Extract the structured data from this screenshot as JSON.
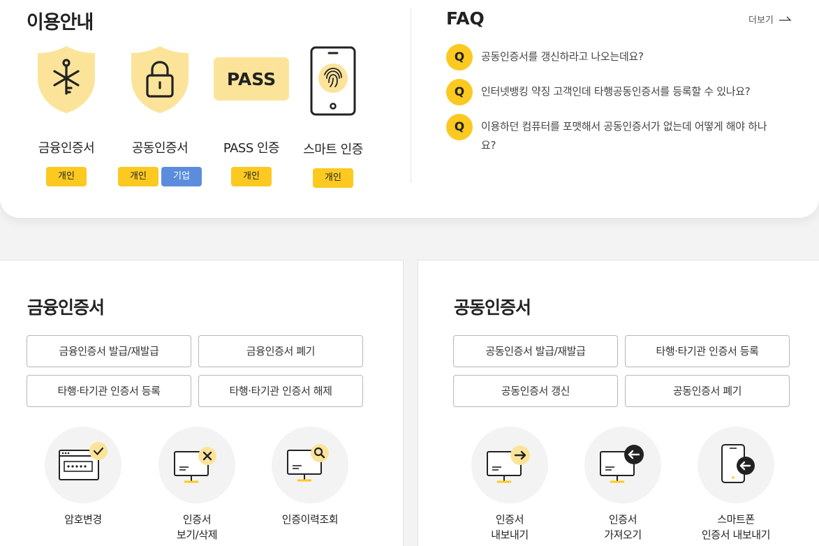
{
  "guide": {
    "title": "이용안내",
    "items": [
      {
        "name": "금융인증서",
        "badges": [
          "개인"
        ]
      },
      {
        "name": "공동인증서",
        "badges": [
          "개인",
          "기업"
        ]
      },
      {
        "name": "PASS 인증",
        "logo_text": "PASS",
        "badges": [
          "개인"
        ]
      },
      {
        "name": "스마트 인증",
        "badges": [
          "개인"
        ]
      }
    ]
  },
  "faq": {
    "title": "FAQ",
    "more_label": "더보기",
    "q_mark": "Q",
    "items": [
      "공동인증서를 갱신하라고 나오는데요?",
      "인터넷뱅킹 약징 고객인데 타행공동인증서를 등록할 수 있나요?",
      "이용하던 컴퓨터를 포맷해서 공동인증서가 없는데 어떻게 해야 하나요?"
    ]
  },
  "financial": {
    "title": "금융인증서",
    "buttons": [
      "금융인증서 발급/재발급",
      "금융인증서 폐기",
      "타행·타기관 인증서 등록",
      "타행·타기관 인증서 해제"
    ],
    "actions": [
      "암호변경",
      "인증서\n보기/삭제",
      "인증이력조회"
    ]
  },
  "joint": {
    "title": "공동인증서",
    "buttons": [
      "공동인증서 발급/재발급",
      "타행·타기관 인증서 등록",
      "공동인증서 갱신",
      "공동인증서 폐기"
    ],
    "actions": [
      "인증서\n내보내기",
      "인증서\n가져오기",
      "스마트폰\n인증서 내보내기"
    ]
  },
  "colors": {
    "accent": "#fcc921",
    "accent_light": "#fbe49a",
    "badge_blue": "#5b8ddc"
  }
}
